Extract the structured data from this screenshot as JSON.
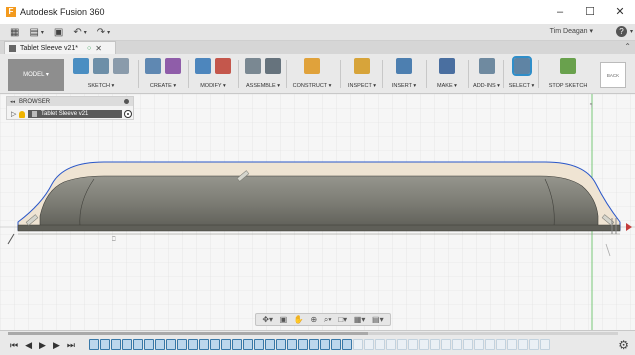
{
  "window": {
    "title": "Autodesk Fusion 360",
    "minimize": "–",
    "maximize": "☐",
    "close": "✕"
  },
  "qat": {
    "grid_icon": "▦",
    "file_icon": "▤",
    "save_icon": "▣",
    "undo_icon": "↶",
    "redo_icon": "↷",
    "dropdown_glyph": "▾",
    "user": "Tim Deagan ▾",
    "help_icon": "?"
  },
  "document_tab": {
    "name": "Tablet Sleeve v21*",
    "sync_icon": "○",
    "close_icon": "✕",
    "collapse_icon": "⌃"
  },
  "toolbar": {
    "workspace": "MODEL ▾",
    "groups": [
      {
        "label": "SKETCH ▾",
        "colors": [
          "#4a8ec2",
          "#6d8fa8",
          "#8a9bab"
        ]
      },
      {
        "label": "CREATE ▾",
        "colors": [
          "#5f88b2",
          "#8f5da9"
        ]
      },
      {
        "label": "MODIFY ▾",
        "colors": [
          "#4d86bd",
          "#c4574c"
        ]
      },
      {
        "label": "ASSEMBLE ▾",
        "colors": [
          "#7a8892",
          "#66737d"
        ]
      },
      {
        "label": "CONSTRUCT ▾",
        "colors": [
          "#e0a23b"
        ]
      },
      {
        "label": "INSPECT ▾",
        "colors": [
          "#d7a43a"
        ]
      },
      {
        "label": "INSERT ▾",
        "colors": [
          "#4d7fb0"
        ]
      },
      {
        "label": "MAKE ▾",
        "colors": [
          "#4a6fa0"
        ]
      },
      {
        "label": "ADD-INS ▾",
        "colors": [
          "#6f8aa0"
        ]
      },
      {
        "label": "SELECT ▾",
        "colors": [
          "#5f84a4"
        ]
      },
      {
        "label": "STOP SKETCH",
        "colors": [
          "#69a14d"
        ]
      }
    ],
    "viewcube_label": "BACK"
  },
  "browser": {
    "collapse_icon": "◂◂",
    "title": "BROWSER",
    "expand_icon": "▷",
    "root_item": "Tablet Sleeve v21"
  },
  "navbar": {
    "icons": [
      "✥▾",
      "▣",
      "✋",
      "⊕",
      "⌕▾",
      "□▾",
      "▦▾",
      "▤▾"
    ]
  },
  "timeline": {
    "first": "⏮",
    "prev": "◀",
    "play": "▶",
    "next": "▶",
    "last": "⏭",
    "active_steps": 24,
    "faded_steps": 18,
    "settings_icon": "⚙"
  },
  "colors": {
    "body_fill": "#7f7f77",
    "sleeve_fill": "#efe4d3",
    "profile_line": "#2a57c9",
    "grid_line": "#dadada",
    "axis_green": "#78c878"
  }
}
